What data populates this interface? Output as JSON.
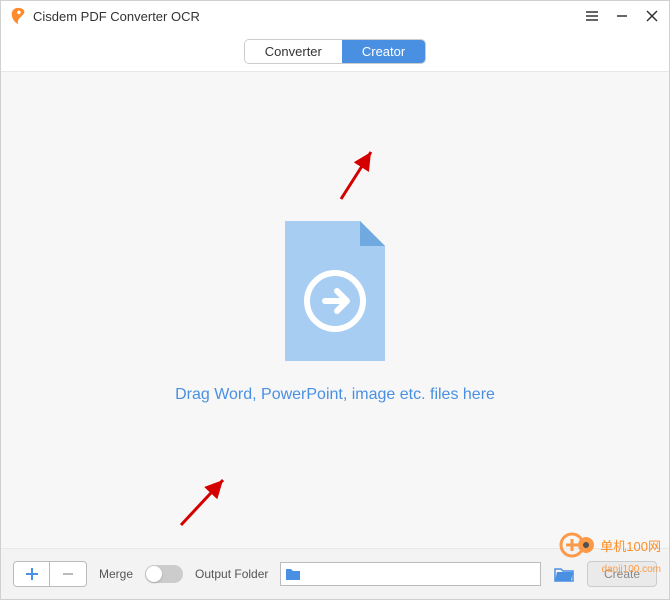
{
  "titlebar": {
    "title": "Cisdem PDF Converter OCR"
  },
  "tabs": {
    "converter": "Converter",
    "creator": "Creator"
  },
  "drop": {
    "text": "Drag Word, PowerPoint, image etc. files here"
  },
  "bottom": {
    "merge_label": "Merge",
    "output_label": "Output Folder",
    "create_label": "Create"
  },
  "watermark": {
    "text": "单机100网",
    "sub": "danji100.com"
  }
}
